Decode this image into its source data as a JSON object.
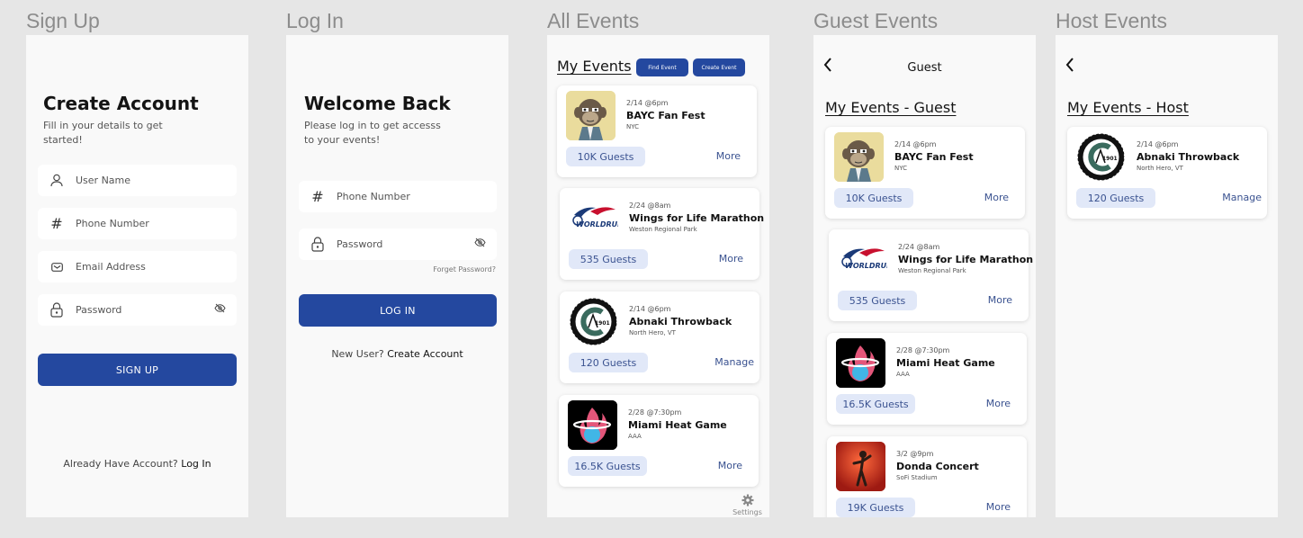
{
  "frames": {
    "signup": {
      "label": "Sign Up"
    },
    "login": {
      "label": "Log In"
    },
    "all_events": {
      "label": "All Events"
    },
    "guest_events": {
      "label": "Guest Events"
    },
    "host_events": {
      "label": "Host Events"
    }
  },
  "signup": {
    "title": "Create Account",
    "subtitle_line1": "Fill in your details to get",
    "subtitle_line2": "started!",
    "username_placeholder": "User Name",
    "phone_placeholder": "Phone Number",
    "email_placeholder": "Email Address",
    "password_placeholder": "Password",
    "button": "SIGN UP",
    "footer_text": "Already Have Account?",
    "footer_link": "Log In"
  },
  "login": {
    "title": "Welcome Back",
    "subtitle_line1": "Please log in to get accesss",
    "subtitle_line2": "to your events!",
    "phone_placeholder": "Phone Number",
    "password_placeholder": "Password",
    "forgot": "Forget Password?",
    "button": "LOG IN",
    "footer_text": "New User?",
    "footer_link": "Create Account"
  },
  "all_events": {
    "title": "My Events",
    "find_button": "Find Event",
    "create_button": "Create Event",
    "settings_label": "Settings",
    "events": [
      {
        "date": "2/14 @6pm",
        "name": "BAYC Fan Fest",
        "location": "NYC",
        "guests": "10K Guests",
        "action": "More"
      },
      {
        "date": "2/24 @8am",
        "name": "Wings for Life Marathon",
        "location": "Weston Regional Park",
        "guests": "535 Guests",
        "action": "More"
      },
      {
        "date": "2/14 @6pm",
        "name": "Abnaki Throwback",
        "location": "North Hero, VT",
        "guests": "120 Guests",
        "action": "Manage"
      },
      {
        "date": "2/28 @7:30pm",
        "name": "Miami Heat Game",
        "location": "AAA",
        "guests": "16.5K Guests",
        "action": "More"
      }
    ]
  },
  "guest_events": {
    "header": "Guest",
    "title": "My Events - Guest",
    "events": [
      {
        "date": "2/14 @6pm",
        "name": "BAYC Fan Fest",
        "location": "NYC",
        "guests": "10K Guests",
        "action": "More"
      },
      {
        "date": "2/24 @8am",
        "name": "Wings for Life Marathon",
        "location": "Weston Regional Park",
        "guests": "535 Guests",
        "action": "More"
      },
      {
        "date": "2/28 @7:30pm",
        "name": "Miami Heat Game",
        "location": "AAA",
        "guests": "16.5K Guests",
        "action": "More"
      },
      {
        "date": "3/2 @9pm",
        "name": "Donda Concert",
        "location": "SoFi Stadium",
        "guests": "19K Guests",
        "action": "More"
      }
    ]
  },
  "host_events": {
    "title": "My Events - Host",
    "events": [
      {
        "date": "2/14 @6pm",
        "name": "Abnaki Throwback",
        "location": "North Hero, VT",
        "guests": "120 Guests",
        "action": "Manage"
      }
    ]
  },
  "logos": {
    "wings_text": "WORLDRUN",
    "abnaki_year": "1901"
  },
  "colors": {
    "primary": "#24489f",
    "pill_bg": "#e1e8f8",
    "pill_text": "#3a5290"
  },
  "icons": [
    "user-icon",
    "hash-icon",
    "mail-icon",
    "lock-icon",
    "eye-off-icon",
    "back-chevron-icon",
    "gear-icon"
  ]
}
